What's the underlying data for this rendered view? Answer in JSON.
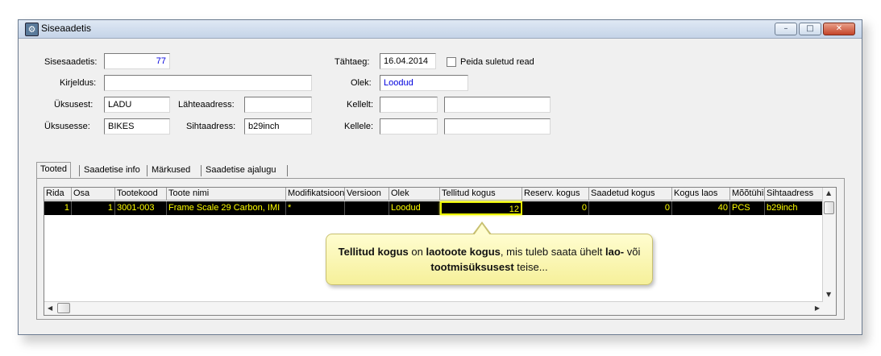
{
  "window": {
    "title": "Siseaadetis",
    "min": "–",
    "max": "□",
    "close": "✕"
  },
  "form": {
    "sisesaadetis_label": "Sisesaadetis:",
    "sisesaadetis_value": "77",
    "kirjeldus_label": "Kirjeldus:",
    "kirjeldus_value": "",
    "uksusest_label": "Üksusest:",
    "uksusest_value": "LADU",
    "lahteaadress_label": "Lähteaadress:",
    "lahteaadress_value": "",
    "uksusesse_label": "Üksusesse:",
    "uksusesse_value": "BIKES",
    "sihtaadress_label": "Sihtaadress:",
    "sihtaadress_value": "b29inch",
    "tahtaeg_label": "Tähtaeg:",
    "tahtaeg_value": "16.04.2014",
    "peida_label": "Peida suletud read",
    "olek_label": "Olek:",
    "olek_value": "Loodud",
    "kellelt_label": "Kellelt:",
    "kellele_label": "Kellele:"
  },
  "tabs": [
    "Tooted",
    "Saadetise info",
    "Märkused",
    "Saadetise ajalugu"
  ],
  "table": {
    "columns": [
      "Rida",
      "Osa",
      "Tootekood",
      "Toote nimi",
      "Modifikatsioon",
      "Versioon",
      "Olek",
      "Tellitud kogus",
      "Reserv. kogus",
      "Saadetud kogus",
      "Kogus laos",
      "Mõõtühik",
      "Sihtaadress"
    ],
    "rows": [
      [
        "1",
        "1",
        "3001-003",
        "Frame Scale 29 Carbon, IMI",
        "*",
        "",
        "Loodud",
        "12",
        "0",
        "0",
        "40",
        "PCS",
        "b29inch"
      ]
    ]
  },
  "callout": {
    "b1": "Tellitud kogus",
    "t1": " on ",
    "b2": "laotoote kogus",
    "t2": ", mis tuleb saata ühelt ",
    "b3": "lao-",
    "t3": " või ",
    "b4": "tootmisüksusest",
    "t4": " teise..."
  }
}
